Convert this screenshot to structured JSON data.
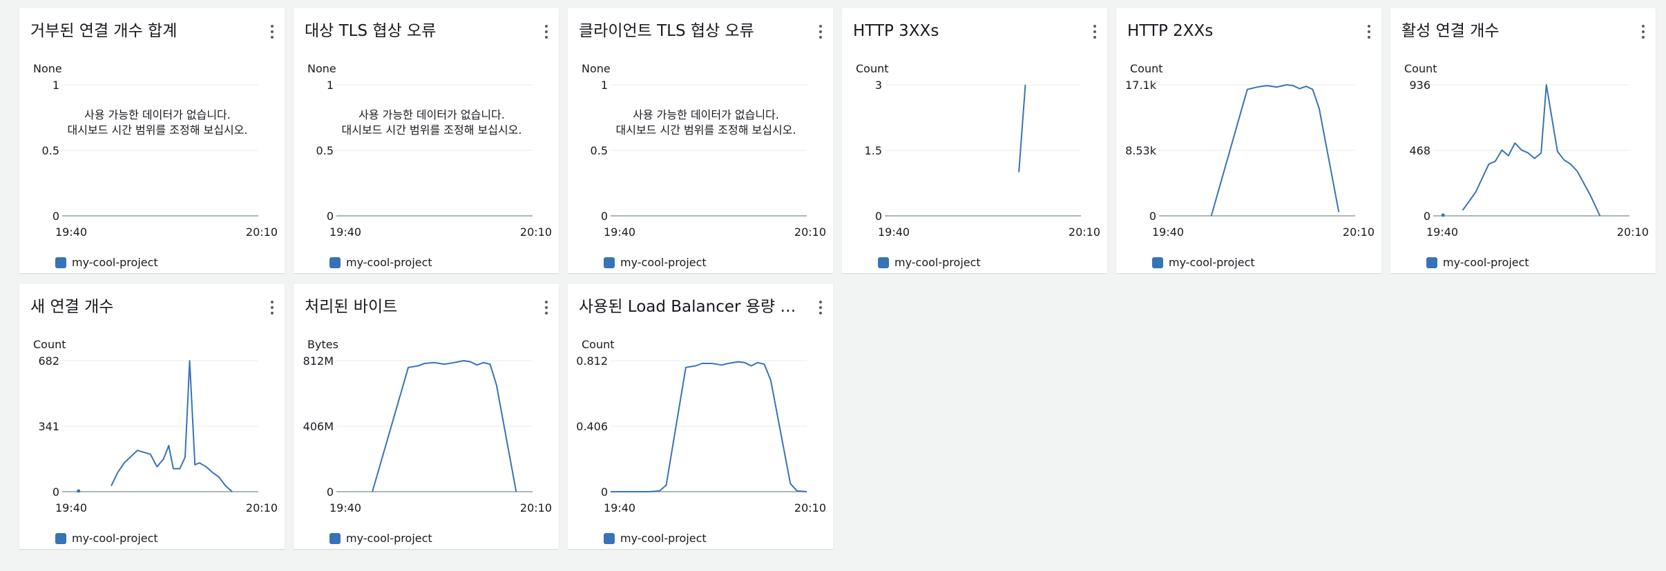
{
  "legend_label": "my-cool-project",
  "series_color": "#3673b7",
  "no_data_line1": "사용 가능한 데이터가 없습니다.",
  "no_data_line2": "대시보드 시간 범위를 조정해 보십시오.",
  "x_axis": {
    "start": "19:40",
    "end": "20:10"
  },
  "widgets": [
    {
      "title": "거부된 연결 개수 합계",
      "unit": "None",
      "y_ticks": [
        "1",
        "0.5",
        "0"
      ],
      "ymax": 1,
      "no_data": true,
      "chart_data": {
        "type": "line",
        "x_range": [
          "19:40",
          "20:10"
        ],
        "ylim": [
          0,
          1
        ],
        "values": []
      }
    },
    {
      "title": "대상 TLS 협상 오류",
      "unit": "None",
      "y_ticks": [
        "1",
        "0.5",
        "0"
      ],
      "ymax": 1,
      "no_data": true,
      "chart_data": {
        "type": "line",
        "x_range": [
          "19:40",
          "20:10"
        ],
        "ylim": [
          0,
          1
        ],
        "values": []
      }
    },
    {
      "title": "클라이언트 TLS 협상 오류",
      "unit": "None",
      "y_ticks": [
        "1",
        "0.5",
        "0"
      ],
      "ymax": 1,
      "no_data": true,
      "chart_data": {
        "type": "line",
        "x_range": [
          "19:40",
          "20:10"
        ],
        "ylim": [
          0,
          1
        ],
        "values": []
      }
    },
    {
      "title": "HTTP 3XXs",
      "unit": "Count",
      "y_ticks": [
        "3",
        "1.5",
        "0"
      ],
      "ymax": 3,
      "no_data": false,
      "chart_data": {
        "type": "line",
        "x_range": [
          "19:40",
          "20:10"
        ],
        "ylim": [
          0,
          3
        ],
        "segments": [
          [
            {
              "t": 20.5,
              "v": 1
            },
            {
              "t": 21.5,
              "v": 3
            }
          ]
        ]
      }
    },
    {
      "title": "HTTP 2XXs",
      "unit": "Count",
      "y_ticks": [
        "17.1k",
        "8.53k",
        "0"
      ],
      "ymax": 17100,
      "no_data": false,
      "chart_data": {
        "type": "line",
        "x_range": [
          "19:40",
          "20:10"
        ],
        "ylim": [
          0,
          17100
        ],
        "segments": [
          [
            {
              "t": 8,
              "v": 0
            },
            {
              "t": 13.5,
              "v": 16500
            },
            {
              "t": 15,
              "v": 16800
            },
            {
              "t": 16.5,
              "v": 17000
            },
            {
              "t": 18,
              "v": 16800
            },
            {
              "t": 19.5,
              "v": 17100
            },
            {
              "t": 20.5,
              "v": 17000
            },
            {
              "t": 21.5,
              "v": 16600
            },
            {
              "t": 22.5,
              "v": 16900
            },
            {
              "t": 23.5,
              "v": 16500
            },
            {
              "t": 24.5,
              "v": 14000
            },
            {
              "t": 27.5,
              "v": 500
            }
          ]
        ]
      }
    },
    {
      "title": "활성 연결 개수",
      "unit": "Count",
      "y_ticks": [
        "936",
        "468",
        "0"
      ],
      "ymax": 936,
      "no_data": false,
      "chart_data": {
        "type": "line",
        "x_range": [
          "19:40",
          "20:10"
        ],
        "ylim": [
          0,
          936
        ],
        "points": [
          {
            "t": 1.5,
            "v": 0
          }
        ],
        "segments": [
          [
            {
              "t": 4.5,
              "v": 40
            },
            {
              "t": 6.5,
              "v": 170
            },
            {
              "t": 8.5,
              "v": 370
            },
            {
              "t": 9.5,
              "v": 390
            },
            {
              "t": 10.5,
              "v": 470
            },
            {
              "t": 11.5,
              "v": 430
            },
            {
              "t": 12.5,
              "v": 520
            },
            {
              "t": 13.5,
              "v": 470
            },
            {
              "t": 14.5,
              "v": 450
            },
            {
              "t": 15.5,
              "v": 410
            },
            {
              "t": 16.5,
              "v": 450
            },
            {
              "t": 17.3,
              "v": 936
            },
            {
              "t": 18,
              "v": 740
            },
            {
              "t": 19,
              "v": 460
            },
            {
              "t": 20,
              "v": 400
            },
            {
              "t": 21,
              "v": 370
            },
            {
              "t": 22,
              "v": 320
            },
            {
              "t": 24,
              "v": 150
            },
            {
              "t": 25.5,
              "v": 0
            }
          ]
        ]
      }
    },
    {
      "title": "새 연결 개수",
      "unit": "Count",
      "y_ticks": [
        "682",
        "341",
        "0"
      ],
      "ymax": 682,
      "no_data": false,
      "chart_data": {
        "type": "line",
        "x_range": [
          "19:40",
          "20:10"
        ],
        "ylim": [
          0,
          682
        ],
        "points": [
          {
            "t": 2.5,
            "v": 0
          }
        ],
        "segments": [
          [
            {
              "t": 7.5,
              "v": 30
            },
            {
              "t": 8.5,
              "v": 100
            },
            {
              "t": 9.5,
              "v": 150
            },
            {
              "t": 11.5,
              "v": 215
            },
            {
              "t": 12.5,
              "v": 205
            },
            {
              "t": 13.5,
              "v": 195
            },
            {
              "t": 14.5,
              "v": 130
            },
            {
              "t": 15.5,
              "v": 170
            },
            {
              "t": 16.3,
              "v": 240
            },
            {
              "t": 17,
              "v": 120
            },
            {
              "t": 18,
              "v": 120
            },
            {
              "t": 18.8,
              "v": 180
            },
            {
              "t": 19.5,
              "v": 682
            },
            {
              "t": 20.3,
              "v": 140
            },
            {
              "t": 21,
              "v": 150
            },
            {
              "t": 22,
              "v": 130
            },
            {
              "t": 23,
              "v": 100
            },
            {
              "t": 24,
              "v": 75
            },
            {
              "t": 25,
              "v": 30
            },
            {
              "t": 26,
              "v": 0
            }
          ]
        ]
      }
    },
    {
      "title": "처리된 바이트",
      "unit": "Bytes",
      "y_ticks": [
        "812M",
        "406M",
        "0"
      ],
      "ymax": 812,
      "no_data": false,
      "chart_data": {
        "type": "line",
        "x_range": [
          "19:40",
          "20:10"
        ],
        "ylim": [
          0,
          812
        ],
        "segments": [
          [
            {
              "t": 5.5,
              "v": 0
            },
            {
              "t": 11,
              "v": 770
            },
            {
              "t": 12.5,
              "v": 780
            },
            {
              "t": 13.5,
              "v": 795
            },
            {
              "t": 15,
              "v": 800
            },
            {
              "t": 16.5,
              "v": 790
            },
            {
              "t": 18,
              "v": 800
            },
            {
              "t": 19.5,
              "v": 812
            },
            {
              "t": 20.5,
              "v": 805
            },
            {
              "t": 21.5,
              "v": 785
            },
            {
              "t": 22.5,
              "v": 800
            },
            {
              "t": 23.5,
              "v": 790
            },
            {
              "t": 24.5,
              "v": 660
            },
            {
              "t": 27.5,
              "v": 0
            }
          ]
        ]
      }
    },
    {
      "title": "사용된 Load Balancer 용량 단위",
      "unit": "Count",
      "y_ticks": [
        "0.812",
        "0.406",
        "0"
      ],
      "ymax": 0.812,
      "no_data": false,
      "chart_data": {
        "type": "line",
        "x_range": [
          "19:40",
          "20:10"
        ],
        "ylim": [
          0,
          0.812
        ],
        "segments": [
          [
            {
              "t": 0,
              "v": 0
            },
            {
              "t": 3,
              "v": 0
            },
            {
              "t": 6,
              "v": 0
            },
            {
              "t": 7.5,
              "v": 0.005
            },
            {
              "t": 8.5,
              "v": 0.04
            },
            {
              "t": 11.5,
              "v": 0.77
            },
            {
              "t": 13,
              "v": 0.78
            },
            {
              "t": 14,
              "v": 0.795
            },
            {
              "t": 15.5,
              "v": 0.795
            },
            {
              "t": 17,
              "v": 0.785
            },
            {
              "t": 18,
              "v": 0.795
            },
            {
              "t": 19.5,
              "v": 0.805
            },
            {
              "t": 20.5,
              "v": 0.8
            },
            {
              "t": 21.5,
              "v": 0.78
            },
            {
              "t": 22.5,
              "v": 0.8
            },
            {
              "t": 23.5,
              "v": 0.79
            },
            {
              "t": 24.5,
              "v": 0.69
            },
            {
              "t": 27.5,
              "v": 0.05
            },
            {
              "t": 28.5,
              "v": 0.005
            },
            {
              "t": 30,
              "v": 0
            }
          ]
        ]
      }
    }
  ]
}
